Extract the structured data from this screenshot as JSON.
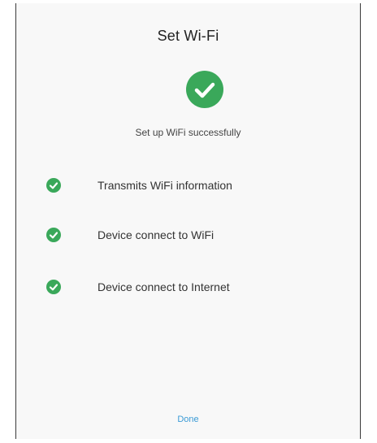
{
  "dialog": {
    "title": "Set Wi-Fi",
    "status_icon": "check-circle-icon",
    "subtitle": "Set up WiFi successfully",
    "accent_color": "#3aa85a",
    "link_color": "#3b9bd6",
    "steps": [
      {
        "label": "Transmits WiFi information",
        "icon": "check-circle-icon",
        "status": "done"
      },
      {
        "label": "Device connect to WiFi",
        "icon": "check-circle-icon",
        "status": "done"
      },
      {
        "label": "Device connect to Internet",
        "icon": "check-circle-icon",
        "status": "done"
      }
    ],
    "done_label": "Done"
  }
}
